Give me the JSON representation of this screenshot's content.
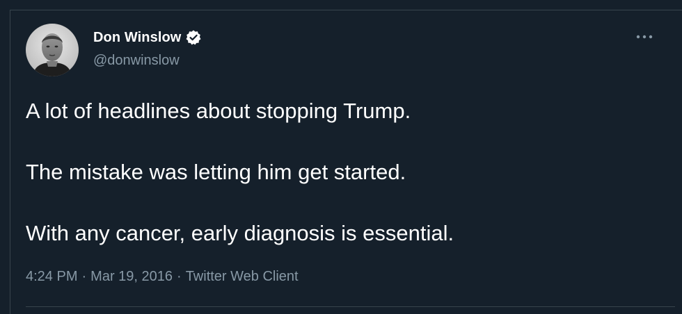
{
  "tweet": {
    "author": {
      "display_name": "Don Winslow",
      "handle": "@donwinslow",
      "verified": true
    },
    "text_lines": [
      "A lot of headlines about stopping Trump.",
      "The mistake was letting him get started.",
      "With any cancer, early diagnosis is essential."
    ],
    "time": "4:24 PM",
    "date": "Mar 19, 2016",
    "source": "Twitter Web Client",
    "separator": "·"
  },
  "icons": {
    "verified": "verified-badge-icon",
    "more": "more-options-icon"
  },
  "colors": {
    "background": "#15202b",
    "primary_text": "#ffffff",
    "secondary_text": "#8899a6",
    "border": "#38444d"
  }
}
